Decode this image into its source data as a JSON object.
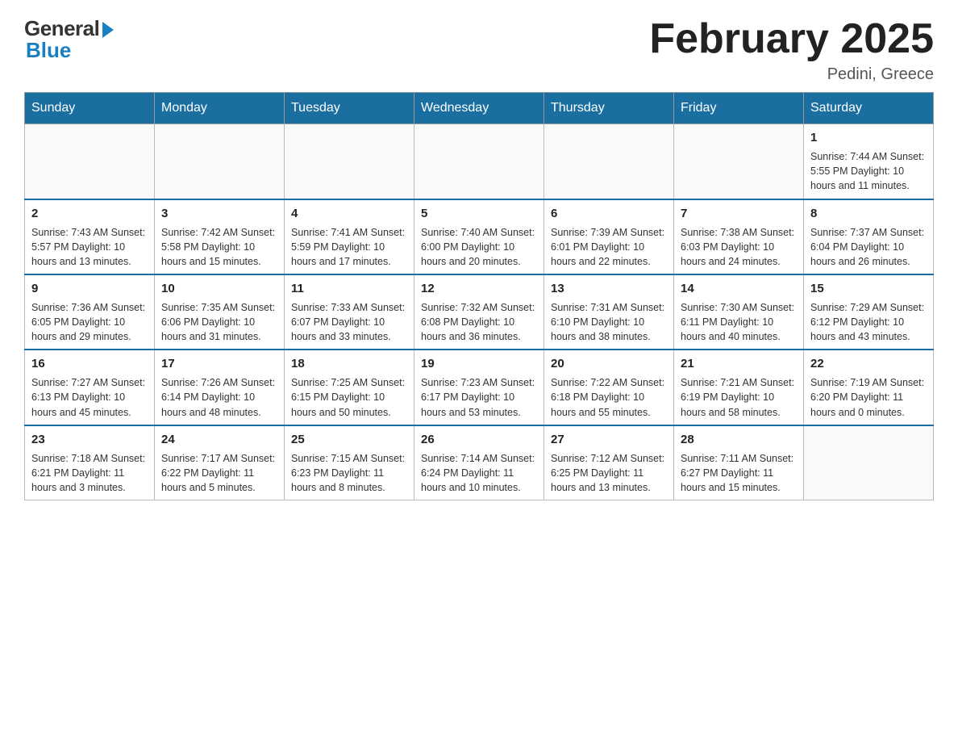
{
  "logo": {
    "general": "General",
    "blue": "Blue"
  },
  "header": {
    "title": "February 2025",
    "subtitle": "Pedini, Greece"
  },
  "weekdays": [
    "Sunday",
    "Monday",
    "Tuesday",
    "Wednesday",
    "Thursday",
    "Friday",
    "Saturday"
  ],
  "weeks": [
    [
      {
        "day": "",
        "info": ""
      },
      {
        "day": "",
        "info": ""
      },
      {
        "day": "",
        "info": ""
      },
      {
        "day": "",
        "info": ""
      },
      {
        "day": "",
        "info": ""
      },
      {
        "day": "",
        "info": ""
      },
      {
        "day": "1",
        "info": "Sunrise: 7:44 AM\nSunset: 5:55 PM\nDaylight: 10 hours\nand 11 minutes."
      }
    ],
    [
      {
        "day": "2",
        "info": "Sunrise: 7:43 AM\nSunset: 5:57 PM\nDaylight: 10 hours\nand 13 minutes."
      },
      {
        "day": "3",
        "info": "Sunrise: 7:42 AM\nSunset: 5:58 PM\nDaylight: 10 hours\nand 15 minutes."
      },
      {
        "day": "4",
        "info": "Sunrise: 7:41 AM\nSunset: 5:59 PM\nDaylight: 10 hours\nand 17 minutes."
      },
      {
        "day": "5",
        "info": "Sunrise: 7:40 AM\nSunset: 6:00 PM\nDaylight: 10 hours\nand 20 minutes."
      },
      {
        "day": "6",
        "info": "Sunrise: 7:39 AM\nSunset: 6:01 PM\nDaylight: 10 hours\nand 22 minutes."
      },
      {
        "day": "7",
        "info": "Sunrise: 7:38 AM\nSunset: 6:03 PM\nDaylight: 10 hours\nand 24 minutes."
      },
      {
        "day": "8",
        "info": "Sunrise: 7:37 AM\nSunset: 6:04 PM\nDaylight: 10 hours\nand 26 minutes."
      }
    ],
    [
      {
        "day": "9",
        "info": "Sunrise: 7:36 AM\nSunset: 6:05 PM\nDaylight: 10 hours\nand 29 minutes."
      },
      {
        "day": "10",
        "info": "Sunrise: 7:35 AM\nSunset: 6:06 PM\nDaylight: 10 hours\nand 31 minutes."
      },
      {
        "day": "11",
        "info": "Sunrise: 7:33 AM\nSunset: 6:07 PM\nDaylight: 10 hours\nand 33 minutes."
      },
      {
        "day": "12",
        "info": "Sunrise: 7:32 AM\nSunset: 6:08 PM\nDaylight: 10 hours\nand 36 minutes."
      },
      {
        "day": "13",
        "info": "Sunrise: 7:31 AM\nSunset: 6:10 PM\nDaylight: 10 hours\nand 38 minutes."
      },
      {
        "day": "14",
        "info": "Sunrise: 7:30 AM\nSunset: 6:11 PM\nDaylight: 10 hours\nand 40 minutes."
      },
      {
        "day": "15",
        "info": "Sunrise: 7:29 AM\nSunset: 6:12 PM\nDaylight: 10 hours\nand 43 minutes."
      }
    ],
    [
      {
        "day": "16",
        "info": "Sunrise: 7:27 AM\nSunset: 6:13 PM\nDaylight: 10 hours\nand 45 minutes."
      },
      {
        "day": "17",
        "info": "Sunrise: 7:26 AM\nSunset: 6:14 PM\nDaylight: 10 hours\nand 48 minutes."
      },
      {
        "day": "18",
        "info": "Sunrise: 7:25 AM\nSunset: 6:15 PM\nDaylight: 10 hours\nand 50 minutes."
      },
      {
        "day": "19",
        "info": "Sunrise: 7:23 AM\nSunset: 6:17 PM\nDaylight: 10 hours\nand 53 minutes."
      },
      {
        "day": "20",
        "info": "Sunrise: 7:22 AM\nSunset: 6:18 PM\nDaylight: 10 hours\nand 55 minutes."
      },
      {
        "day": "21",
        "info": "Sunrise: 7:21 AM\nSunset: 6:19 PM\nDaylight: 10 hours\nand 58 minutes."
      },
      {
        "day": "22",
        "info": "Sunrise: 7:19 AM\nSunset: 6:20 PM\nDaylight: 11 hours\nand 0 minutes."
      }
    ],
    [
      {
        "day": "23",
        "info": "Sunrise: 7:18 AM\nSunset: 6:21 PM\nDaylight: 11 hours\nand 3 minutes."
      },
      {
        "day": "24",
        "info": "Sunrise: 7:17 AM\nSunset: 6:22 PM\nDaylight: 11 hours\nand 5 minutes."
      },
      {
        "day": "25",
        "info": "Sunrise: 7:15 AM\nSunset: 6:23 PM\nDaylight: 11 hours\nand 8 minutes."
      },
      {
        "day": "26",
        "info": "Sunrise: 7:14 AM\nSunset: 6:24 PM\nDaylight: 11 hours\nand 10 minutes."
      },
      {
        "day": "27",
        "info": "Sunrise: 7:12 AM\nSunset: 6:25 PM\nDaylight: 11 hours\nand 13 minutes."
      },
      {
        "day": "28",
        "info": "Sunrise: 7:11 AM\nSunset: 6:27 PM\nDaylight: 11 hours\nand 15 minutes."
      },
      {
        "day": "",
        "info": ""
      }
    ]
  ]
}
